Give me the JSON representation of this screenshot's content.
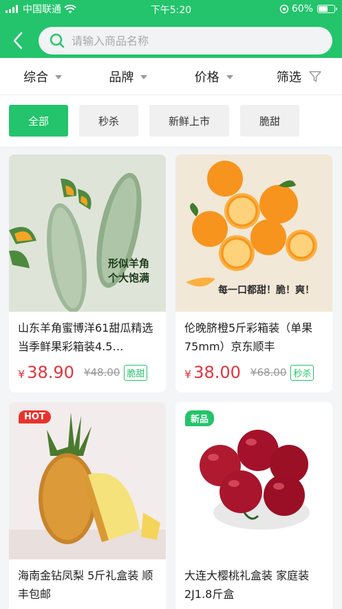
{
  "status": {
    "carrier": "中国联通",
    "time": "下午5:20",
    "battery": "60%",
    "battery_level": 0.6
  },
  "search": {
    "placeholder": "请输入商品名称"
  },
  "sort": [
    {
      "label": "综合"
    },
    {
      "label": "品牌"
    },
    {
      "label": "价格"
    },
    {
      "label": "筛选"
    }
  ],
  "tags": [
    {
      "label": "全部",
      "active": true
    },
    {
      "label": "秒杀"
    },
    {
      "label": "新鲜上市"
    },
    {
      "label": "脆甜"
    }
  ],
  "products": [
    {
      "title": "山东羊角蜜博洋61甜瓜精选当季鲜果彩箱装4.5…",
      "price": "38.90",
      "old_price": "¥48.00",
      "badge": "脆甜",
      "img_text": "形似羊角\n个大饱满"
    },
    {
      "title": "伦晚脐橙5斤彩箱装（单果75mm）京东顺丰",
      "price": "38.00",
      "old_price": "¥68.00",
      "badge": "秒杀",
      "img_text": "每一口都甜！脆！爽！"
    },
    {
      "title": "海南金钻凤梨 5斤礼盒装 顺丰包邮",
      "corner": "HOT"
    },
    {
      "title": "大连大樱桃礼盒装 家庭装2J1.8斤盒",
      "corner": "新品"
    }
  ],
  "currency": "¥",
  "colors": {
    "brand": "#23c46b",
    "price": "#e0353b"
  }
}
